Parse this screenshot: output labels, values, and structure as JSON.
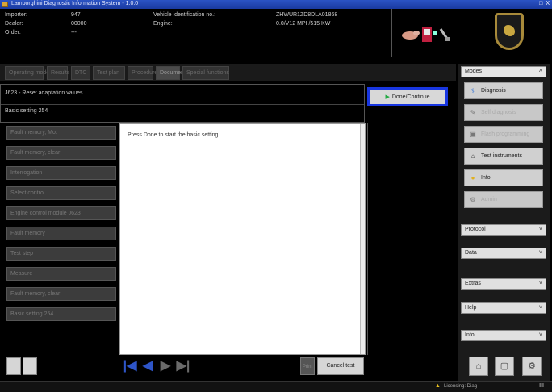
{
  "window": {
    "title": "Lamborghini Diagnostic Information System - 1.0.0",
    "controls": "_ □ X"
  },
  "header": {
    "importer_label": "Importer:",
    "importer_value": "947",
    "dealer_label": "Dealer:",
    "dealer_value": "00000",
    "order_label": "Order:",
    "order_value": "---",
    "vehicle_id_label": "Vehicle identification no.:",
    "vehicle_id_value": "ZHWUR1ZD8DLA01868",
    "engine_label": "Engine:",
    "engine_value": "0.0/V12 MPI /515 KW"
  },
  "tabs": [
    {
      "label": "Operating mode"
    },
    {
      "label": "Results"
    },
    {
      "label": "DTC"
    },
    {
      "label": "Test plan"
    },
    {
      "label": "Procedure"
    },
    {
      "label": "Documents"
    },
    {
      "label": "Special functions"
    }
  ],
  "function": {
    "title": "J623 - Reset adaptation values",
    "subtitle": "Basic setting 254"
  },
  "done_button": {
    "label": "Done/Continue"
  },
  "left_menu": [
    {
      "label": "Fault memory, Mot"
    },
    {
      "label": "Fault memory, clear"
    },
    {
      "label": "Interrogation"
    },
    {
      "label": "Select control"
    },
    {
      "label": "Engine control module J623"
    },
    {
      "label": "Fault memory"
    },
    {
      "label": "Test step"
    },
    {
      "label": "Measure"
    },
    {
      "label": "Fault memory, clear"
    },
    {
      "label": "Basic setting 254"
    }
  ],
  "content": {
    "message": "Press Done to start the basic setting."
  },
  "sidebar": {
    "modes_label": "Modes",
    "buttons": [
      {
        "label": "Diagnosis",
        "icon": "stethoscope-icon",
        "glyph": "⚕",
        "disabled": false
      },
      {
        "label": "Self diagnosis",
        "icon": "wrench-icon",
        "glyph": "✎",
        "disabled": true
      },
      {
        "label": "Flash programming",
        "icon": "chip-icon",
        "glyph": "▣",
        "disabled": true
      },
      {
        "label": "Test instruments",
        "icon": "instrument-icon",
        "glyph": "⌂",
        "disabled": false
      },
      {
        "label": "Info",
        "icon": "info-icon",
        "glyph": "●",
        "disabled": false
      },
      {
        "label": "Admin",
        "icon": "admin-icon",
        "glyph": "⚙",
        "disabled": true
      }
    ],
    "sections": [
      {
        "label": "Protocol"
      },
      {
        "label": "Data"
      },
      {
        "label": "Extras"
      },
      {
        "label": "Help"
      },
      {
        "label": "Info"
      }
    ]
  },
  "bottom_toolbar": {
    "cancel_label": "Cancel test",
    "print_label": "Print"
  },
  "statusbar": {
    "warning_text": "Licensing: Diag",
    "page_indicator": "III"
  },
  "colors": {
    "highlight_border": "#1836e0",
    "nav_blue": "#2e55c8",
    "nav_gray": "#6a6a6a",
    "warning": "#e7c020"
  }
}
